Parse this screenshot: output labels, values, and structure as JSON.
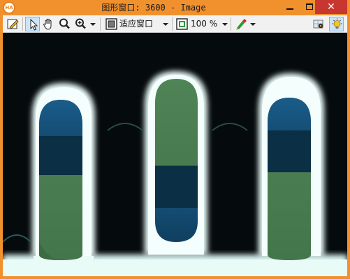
{
  "window": {
    "title": "图形窗口: 3600 - Image",
    "logo_text": "HA",
    "close_glyph": "✕"
  },
  "toolbar": {
    "fit_label": "适应窗口",
    "zoom_label": "100 %",
    "icons": [
      "edit-icon",
      "pointer-icon",
      "hand-icon",
      "magnifier-icon",
      "zoom-in-icon",
      "fit-window-icon",
      "zoom-icon",
      "color-pen-icon",
      "grid-settings-icon",
      "light-bulb-icon"
    ]
  },
  "colors": {
    "titlebar": "#f0912e",
    "close_button": "#c7372f",
    "viewport_bg": "#050a0c"
  }
}
